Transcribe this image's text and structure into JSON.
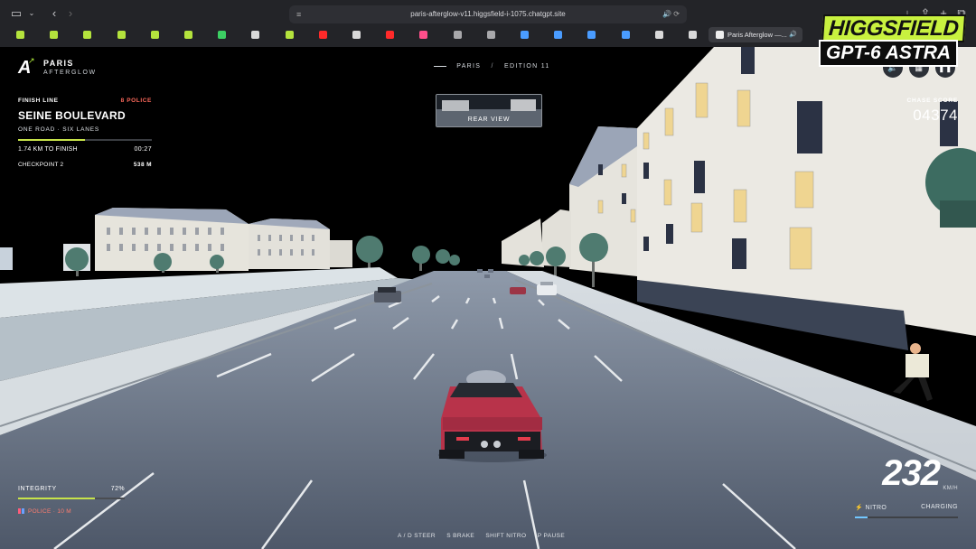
{
  "browser": {
    "url": "paris-afterglow-v11.higgsfield-i-1075.chatgpt.site",
    "active_tab_title": "Paris Afterglow —...",
    "favicons": [
      {
        "icon": "green-square-icon",
        "color": "#b4e33d"
      },
      {
        "icon": "green-square-icon",
        "color": "#b4e33d"
      },
      {
        "icon": "green-square-icon",
        "color": "#b4e33d"
      },
      {
        "icon": "green-square-icon",
        "color": "#b4e33d"
      },
      {
        "icon": "green-square-icon",
        "color": "#b4e33d"
      },
      {
        "icon": "green-square-icon",
        "color": "#b4e33d"
      },
      {
        "icon": "whatsapp-icon",
        "color": "#3ccf63"
      },
      {
        "icon": "openai-icon",
        "color": "#d9d9d9"
      },
      {
        "icon": "green-square-icon",
        "color": "#b4e33d"
      },
      {
        "icon": "youtube-icon",
        "color": "#ff2a2a"
      },
      {
        "icon": "app-icon",
        "color": "#d9d9d9"
      },
      {
        "icon": "youtube-icon",
        "color": "#ff2a2a"
      },
      {
        "icon": "pink-app-icon",
        "color": "#ff4f8b"
      },
      {
        "icon": "grey-app-icon",
        "color": "#a8a8ab"
      },
      {
        "icon": "grey-app-icon",
        "color": "#a8a8ab"
      },
      {
        "icon": "blue-grid-icon",
        "color": "#4a9cff"
      },
      {
        "icon": "blue-grid-icon",
        "color": "#4a9cff"
      },
      {
        "icon": "blue-grid-icon",
        "color": "#4a9cff"
      },
      {
        "icon": "blue-grid-icon",
        "color": "#4a9cff"
      },
      {
        "icon": "openai-icon",
        "color": "#d9d9d9"
      },
      {
        "icon": "openai-icon",
        "color": "#d9d9d9"
      }
    ]
  },
  "brand": {
    "logo": "A",
    "line1": "PARIS",
    "line2": "AFTERGLOW"
  },
  "edition": {
    "city": "PARIS",
    "label": "EDITION 11"
  },
  "rear_view": {
    "label": "REAR VIEW"
  },
  "mission": {
    "label": "FINISH LINE",
    "police": "8 POLICE",
    "title": "SEINE BOULEVARD",
    "subtitle": "ONE ROAD · SIX LANES",
    "progress": 0.5,
    "distance": "1.74 KM TO FINISH",
    "time": "00:27",
    "checkpoint": "CHECKPOINT 2",
    "checkpoint_distance": "538 M"
  },
  "score": {
    "label": "CHASE SCORE",
    "value": "04374"
  },
  "integrity": {
    "label": "INTEGRITY",
    "value": "72%",
    "level": 0.72,
    "police": "POLICE · 10 M"
  },
  "speed": {
    "value": "232",
    "unit": "KM/H",
    "nitro_label": "NITRO",
    "nitro_status": "CHARGING",
    "nitro_level": 0.12
  },
  "controls": [
    "A / D  STEER",
    "S  BRAKE",
    "SHIFT  NITRO",
    "P  PAUSE"
  ],
  "watermark": {
    "line1": "HIGGSFIELD",
    "line2": "GPT-6 ASTRA"
  },
  "colors": {
    "accent": "#c7e34a",
    "police": "#ff6a5c",
    "nitro": "#72c7ff",
    "car": "#b8334a"
  }
}
